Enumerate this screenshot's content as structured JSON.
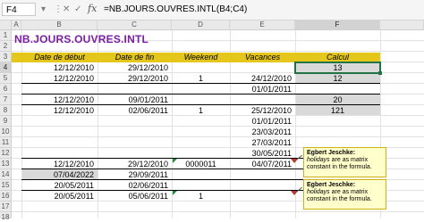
{
  "formula_bar": {
    "name_box": "F4",
    "fx": "fx",
    "formula": "=NB.JOURS.OUVRES.INTL(B4;C4)"
  },
  "columns": [
    "A",
    "B",
    "C",
    "D",
    "E",
    "F"
  ],
  "rows": [
    "1",
    "2",
    "3",
    "4",
    "5",
    "6",
    "7",
    "8",
    "9",
    "10",
    "11",
    "12",
    "13",
    "14",
    "15",
    "16",
    "17",
    "18"
  ],
  "title": "NB.JOURS.OUVRES.INTL",
  "headers": {
    "b": "Date de début",
    "c": "Date de fin",
    "d": "Weekend",
    "e": "Vacances",
    "f": "Calcul"
  },
  "table": {
    "r4": {
      "b": "12/12/2010",
      "c": "29/12/2010",
      "d": "",
      "e": "",
      "f": "13"
    },
    "r5": {
      "b": "12/12/2010",
      "c": "29/12/2010",
      "d": "1",
      "e": "24/12/2010",
      "f": "12"
    },
    "r6": {
      "b": "",
      "c": "",
      "d": "",
      "e": "01/01/2011",
      "f": ""
    },
    "r7": {
      "b": "12/12/2010",
      "c": "09/01/2011",
      "d": "",
      "e": "",
      "f": "20"
    },
    "r8": {
      "b": "12/12/2010",
      "c": "02/06/2011",
      "d": "1",
      "e": "25/12/2010",
      "f": "121"
    },
    "r9": {
      "b": "",
      "c": "",
      "d": "",
      "e": "01/01/2011",
      "f": ""
    },
    "r10": {
      "b": "",
      "c": "",
      "d": "",
      "e": "23/03/2011",
      "f": ""
    },
    "r11": {
      "b": "",
      "c": "",
      "d": "",
      "e": "27/03/2011",
      "f": ""
    },
    "r12": {
      "b": "",
      "c": "",
      "d": "",
      "e": "30/05/2011",
      "f": ""
    },
    "r13": {
      "b": "",
      "c": "",
      "d": "",
      "e": "04/07/2011",
      "f": ""
    },
    "r14": {
      "b": "12/12/2010",
      "c": "29/12/2010",
      "d": "0000011",
      "e": "",
      "f": ""
    },
    "r15": {
      "b": "07/04/2022",
      "c": "29/09/2011",
      "d": "",
      "e": "",
      "f": ""
    },
    "r16": {
      "b": "20/05/2011",
      "c": "02/06/2011",
      "d": "",
      "e": "",
      "f": ""
    },
    "r17": {
      "b": "20/05/2011",
      "c": "05/06/2011",
      "d": "1",
      "e": "",
      "f": ""
    }
  },
  "comments": [
    {
      "author": "Egbert Jeschke:",
      "italic": "holidays",
      "text": " are as matrix constant in the formula."
    },
    {
      "author": "Egbert Jeschke:",
      "italic": "holidays",
      "text": " are as matrix constant in the formula."
    }
  ],
  "colors": {
    "title": "#7a1fa2",
    "header_band": "#e5c61a",
    "selection": "#217346",
    "comment_bg": "#ffffcc"
  }
}
